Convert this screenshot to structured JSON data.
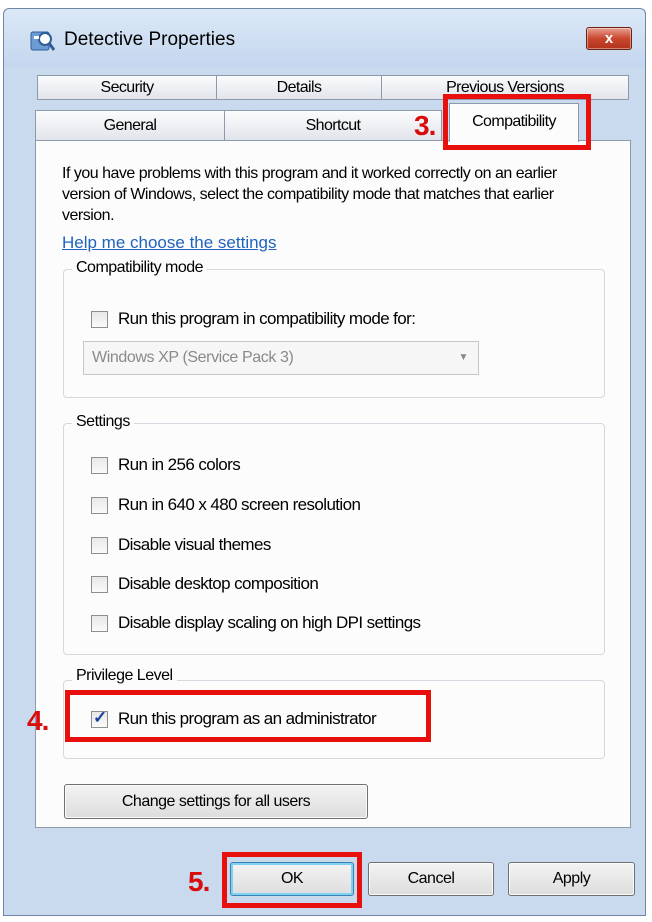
{
  "window": {
    "title": "Detective Properties",
    "close_label": "x"
  },
  "tabs": {
    "row1": [
      "Security",
      "Details",
      "Previous Versions"
    ],
    "row2": [
      "General",
      "Shortcut",
      "Compatibility"
    ]
  },
  "intro_text": "If you have problems with this program and it worked correctly on an earlier version of Windows, select the compatibility mode that matches that earlier version.",
  "help_link": "Help me choose the settings",
  "compatibility_mode": {
    "legend": "Compatibility mode",
    "checkbox_label": "Run this program in compatibility mode for:",
    "checked": false,
    "select_value": "Windows XP (Service Pack 3)"
  },
  "settings": {
    "legend": "Settings",
    "items": [
      {
        "label": "Run in 256 colors",
        "checked": false
      },
      {
        "label": "Run in 640 x 480 screen resolution",
        "checked": false
      },
      {
        "label": "Disable visual themes",
        "checked": false
      },
      {
        "label": "Disable desktop composition",
        "checked": false
      },
      {
        "label": "Disable display scaling on high DPI settings",
        "checked": false
      }
    ]
  },
  "privilege": {
    "legend": "Privilege Level",
    "checkbox_label": "Run this program as an administrator",
    "checked": true
  },
  "change_all_button": "Change settings for all users",
  "buttons": {
    "ok": "OK",
    "cancel": "Cancel",
    "apply": "Apply"
  },
  "annotations": {
    "step3": "3.",
    "step4": "4.",
    "step5": "5.",
    "color": "#e8100c"
  },
  "colors": {
    "link": "#1e64bf",
    "titlebar": "#c4d6ee",
    "close": "#c9472f"
  }
}
